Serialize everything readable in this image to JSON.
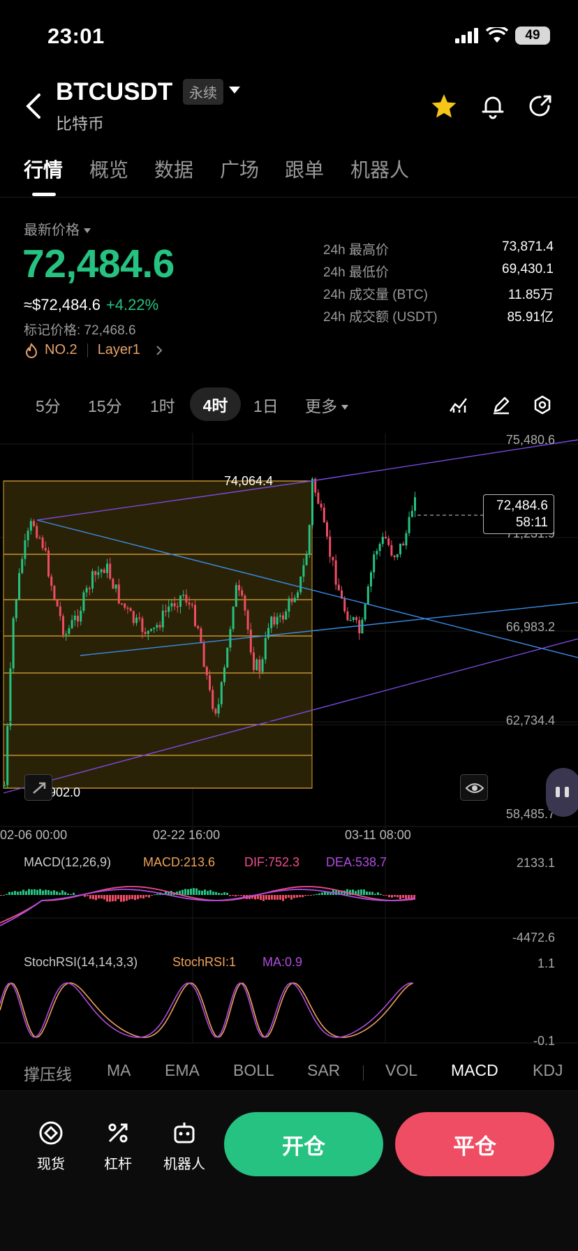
{
  "status_bar": {
    "time": "23:01",
    "battery": "49"
  },
  "header": {
    "symbol": "BTCUSDT",
    "contract_type": "永续",
    "subtitle": "比特币"
  },
  "tabs": [
    "行情",
    "概览",
    "数据",
    "广场",
    "跟单",
    "机器人"
  ],
  "ticker": {
    "label": "最新价格",
    "last_price": "72,484.6",
    "usd_price": "≈$72,484.6",
    "change": "+4.22%",
    "mark_price": "标记价格: 72,468.6",
    "rank": "NO.2",
    "sector": "Layer1"
  },
  "stats": [
    {
      "k": "24h 最高价",
      "v": "73,871.4"
    },
    {
      "k": "24h 最低价",
      "v": "69,430.1"
    },
    {
      "k": "24h 成交量 (BTC)",
      "v": "11.85万"
    },
    {
      "k": "24h 成交额 (USDT)",
      "v": "85.91亿"
    }
  ],
  "intervals": [
    "5分",
    "15分",
    "1时",
    "4时",
    "1日",
    "更多"
  ],
  "active_interval": "4时",
  "chart": {
    "y_axis": [
      "75,480.6",
      "71,231.9",
      "66,983.2",
      "62,734.4",
      "58,485.7"
    ],
    "x_axis": [
      "02-06 00:00",
      "02-22 16:00",
      "03-11 08:00"
    ],
    "high_marker": "74,064.4",
    "low_marker": "59,902.0",
    "current_price": "72,484.6",
    "countdown": "58:11"
  },
  "macd": {
    "name": "MACD(12,26,9)",
    "macd": "MACD:213.6",
    "dif": "DIF:752.3",
    "dea": "DEA:538.7",
    "y_top": "2133.1",
    "y_bottom": "-4472.6"
  },
  "stoch": {
    "name": "StochRSI(14,14,3,3)",
    "value": "StochRSI:1",
    "ma": "MA:0.9",
    "y_top": "1.1",
    "y_bottom": "-0.1"
  },
  "indicator_tabs": [
    "撑压线",
    "MA",
    "EMA",
    "BOLL",
    "SAR",
    "VOL",
    "MACD",
    "KDJ"
  ],
  "bottom": {
    "spot": "现货",
    "leverage": "杠杆",
    "bot": "机器人",
    "open": "开仓",
    "close": "平仓"
  },
  "colors": {
    "up": "#26c281",
    "down": "#ef4d63",
    "dif": "#ef4d8f",
    "dea": "#b04ce0"
  }
}
